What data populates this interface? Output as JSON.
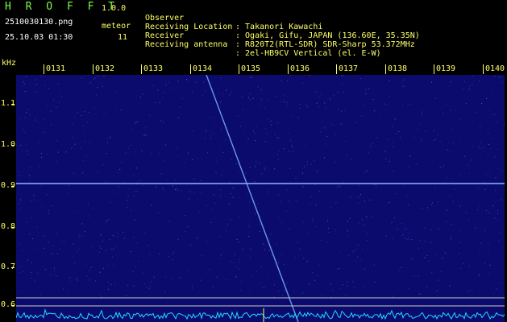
{
  "header": {
    "app_name": "H R O F F T",
    "version": "1.0.0",
    "filename": "2510030130.png",
    "meteor_label": "meteor",
    "datetime": "25.10.03 01:30",
    "meteor_count": "11"
  },
  "info": [
    {
      "label": "Observer",
      "value": ": Takanori Kawachi"
    },
    {
      "label": "Receiving Location",
      "value": ": Ogaki, Gifu, JAPAN (136.60E, 35.35N)"
    },
    {
      "label": "Receiver",
      "value": ": R820T2(RTL-SDR) SDR-Sharp 53.372MHz"
    },
    {
      "label": "Receiving antenna",
      "value": ": 2el-HB9CV Vertical (el. E-W)"
    }
  ],
  "axis": {
    "unit": "kHz",
    "time_ticks": [
      "0131",
      "0132",
      "0133",
      "0134",
      "0135",
      "0136",
      "0137",
      "0138",
      "0139",
      "0140"
    ],
    "freq_ticks": [
      "1.1",
      "1.0",
      "0.9",
      "0.8",
      "0.7",
      "0.6"
    ]
  },
  "colors": {
    "background": "#000000",
    "plot_bg": "#0b0b6e",
    "label_yellow": "#ffff66",
    "title_green": "#7cfc4a",
    "trace": "#7fb0ff",
    "spectrum": "#22d8ff"
  }
}
